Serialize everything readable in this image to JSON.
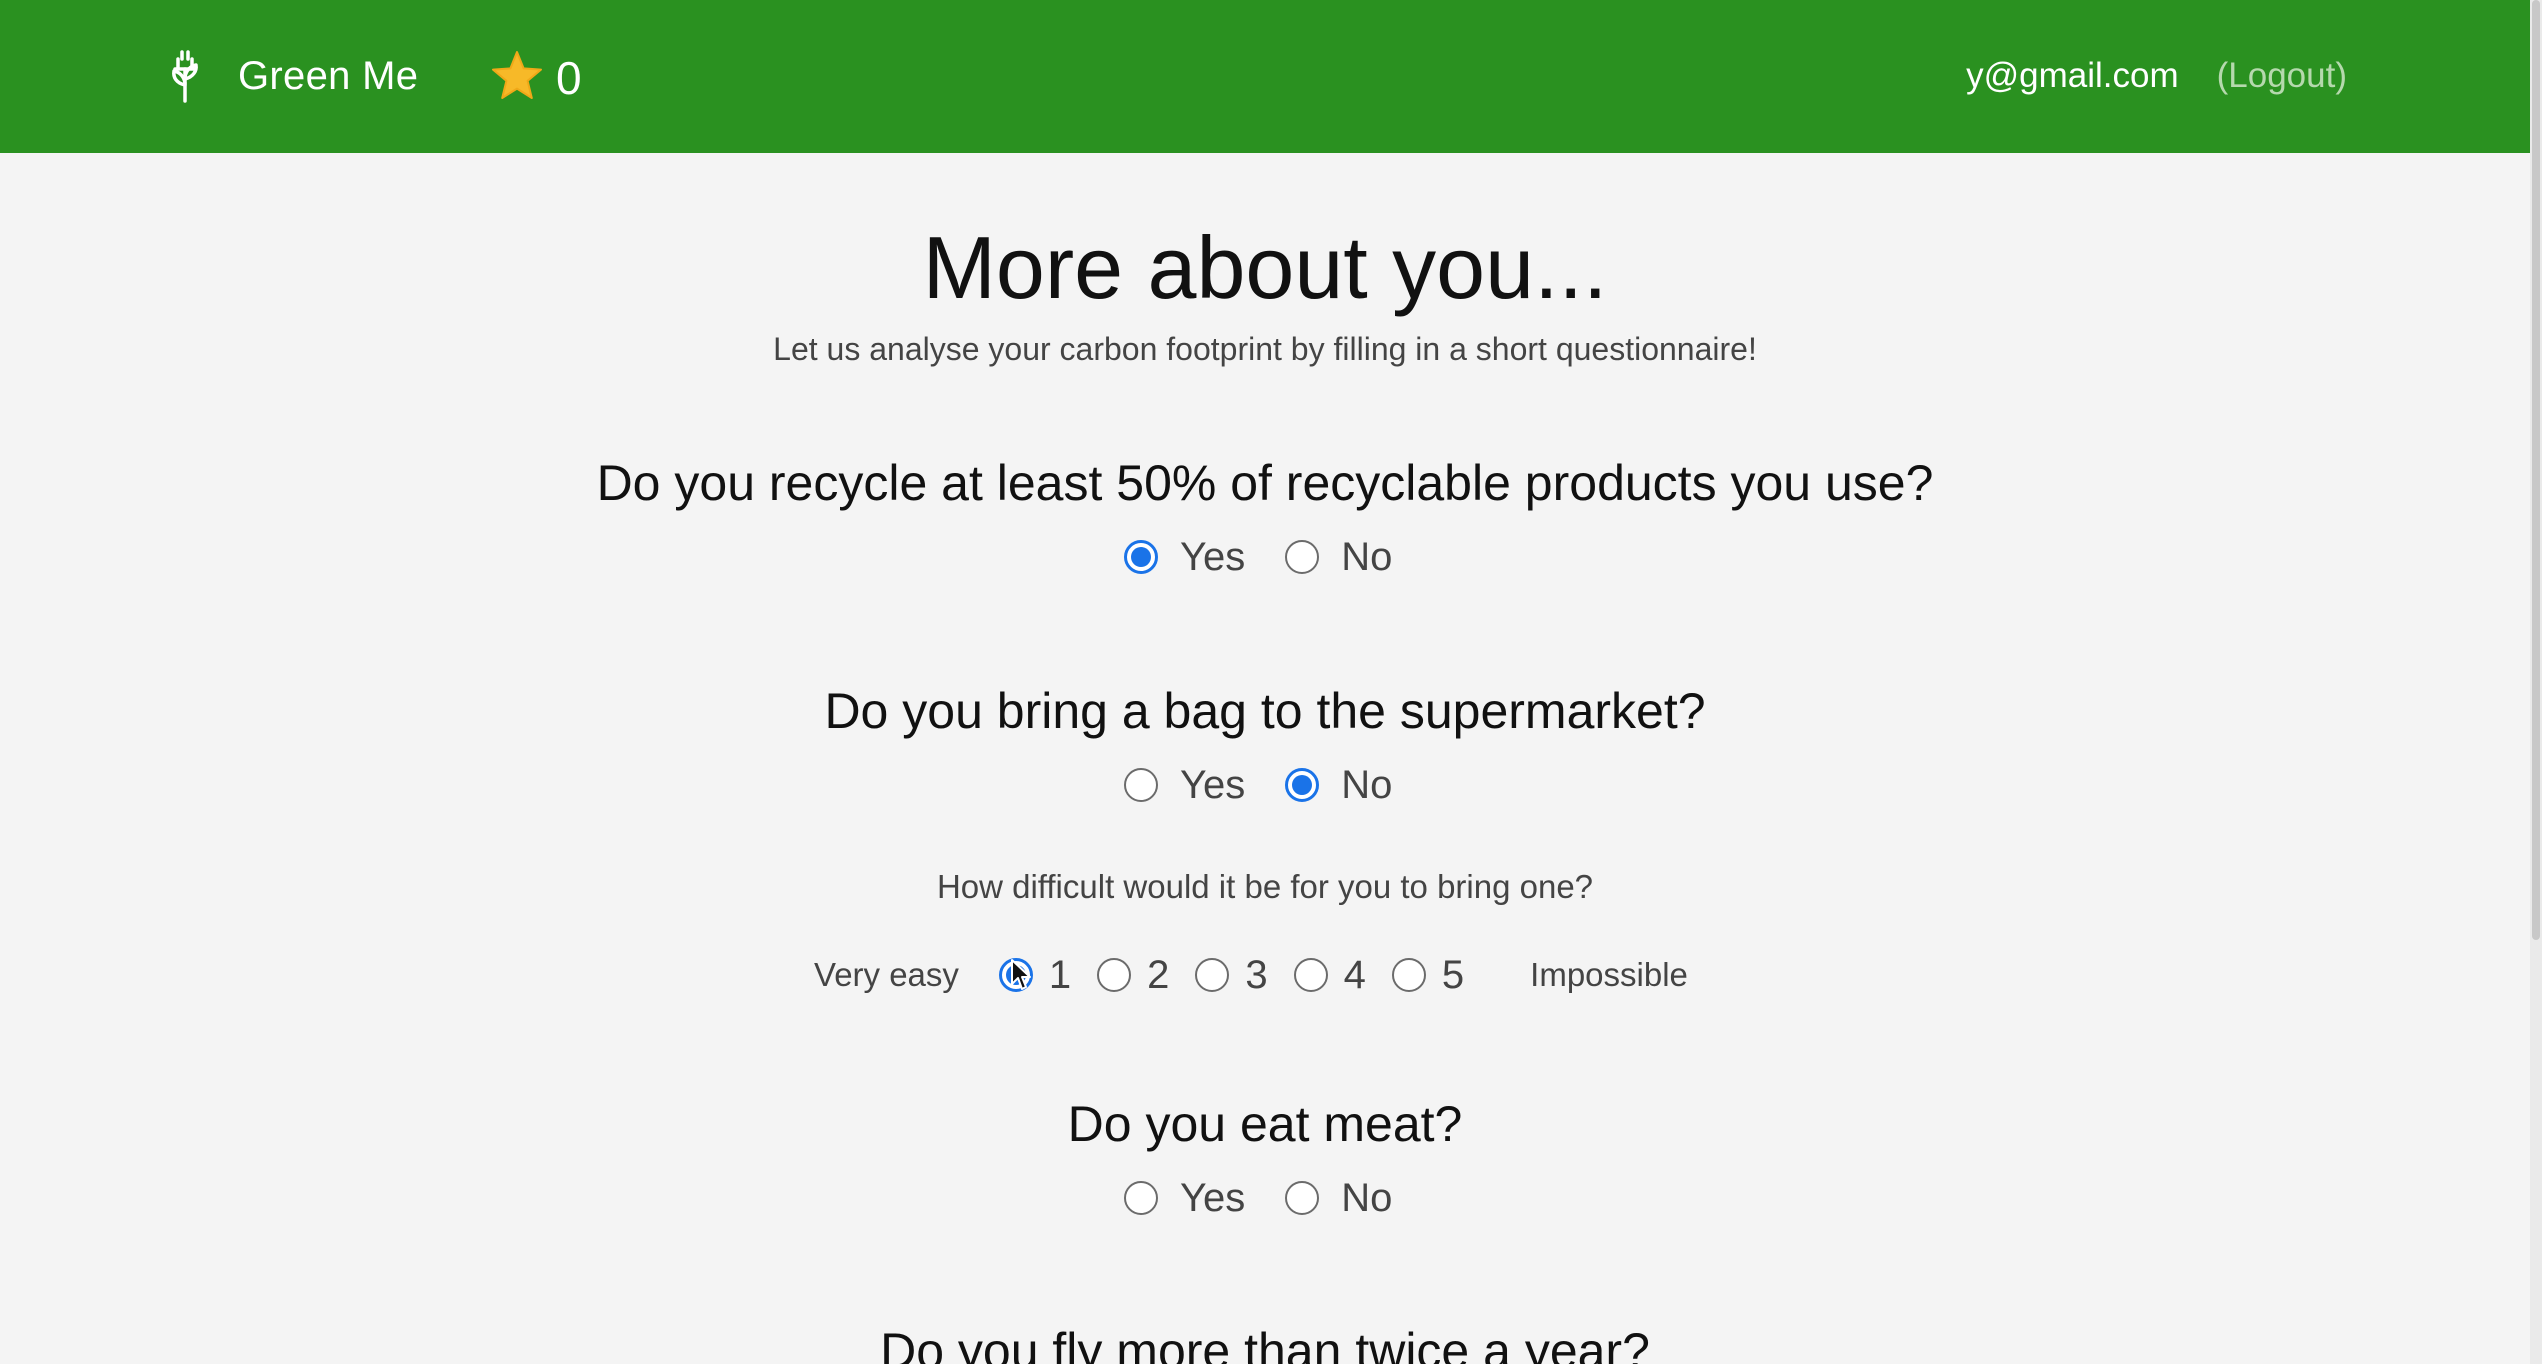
{
  "header": {
    "app_name": "Green Me",
    "logo_icon": "plant-plug-icon",
    "star_icon": "star-icon",
    "star_count": "0",
    "user_email": "y@gmail.com",
    "logout_label": "(Logout)",
    "brand_color": "#2a9120"
  },
  "page": {
    "title": "More about you...",
    "subtitle": "Let us analyse your carbon footprint by filling in a short questionnaire!"
  },
  "questions": {
    "recycle": {
      "text": "Do you recycle at least 50% of recyclable products you use?",
      "yes_label": "Yes",
      "no_label": "No",
      "selected": "Yes"
    },
    "bag": {
      "text": "Do you bring a bag to the supermarket?",
      "yes_label": "Yes",
      "no_label": "No",
      "selected": "No"
    },
    "difficulty": {
      "text": "How difficult would it be for you to bring one?",
      "low_label": "Very easy",
      "high_label": "Impossible",
      "options": [
        "1",
        "2",
        "3",
        "4",
        "5"
      ],
      "selected": "1"
    },
    "meat": {
      "text": "Do you eat meat?",
      "yes_label": "Yes",
      "no_label": "No",
      "selected": ""
    },
    "fly": {
      "text": "Do you fly more than twice a year?"
    }
  },
  "accent_color": "#1a73e8"
}
